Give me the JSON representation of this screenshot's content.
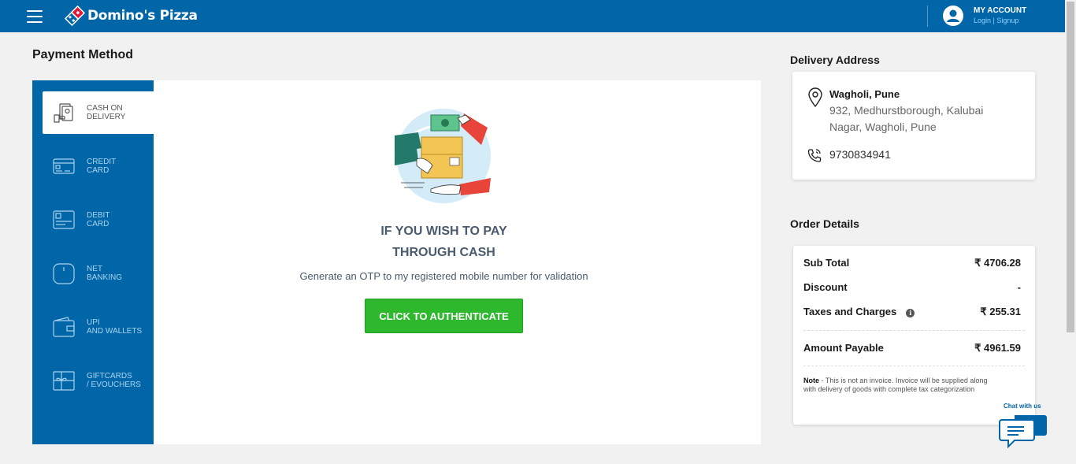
{
  "header": {
    "brand": "Domino's Pizza",
    "account_title": "MY ACCOUNT",
    "login": "Login",
    "separator": " | ",
    "signup": "Signup"
  },
  "payment": {
    "title": "Payment Method",
    "methods": [
      {
        "label": "CASH ON\nDELIVERY",
        "icon": "cash-icon",
        "active": true
      },
      {
        "label": "CREDIT\nCARD",
        "icon": "credit-card-icon",
        "active": false
      },
      {
        "label": "DEBIT\nCARD",
        "icon": "debit-card-icon",
        "active": false
      },
      {
        "label": "NET\nBANKING",
        "icon": "mouse-icon",
        "active": false
      },
      {
        "label": "UPI\nAND WALLETS",
        "icon": "wallet-icon",
        "active": false
      },
      {
        "label": "GIFTCARDS\n/ EVOUCHERS",
        "icon": "giftcard-icon",
        "active": false
      }
    ],
    "heading": "IF YOU WISH TO PAY\nTHROUGH CASH",
    "otp_text": "Generate an OTP to my registered mobile number for validation",
    "button": "CLICK TO AUTHENTICATE"
  },
  "delivery": {
    "title": "Delivery Address",
    "name": "Wagholi, Pune",
    "address": "932, Medhurstborough, Kalubai Nagar, Wagholi, Pune",
    "phone": "9730834941"
  },
  "order": {
    "title": "Order Details",
    "sub_total_label": "Sub Total",
    "sub_total": "₹ 4706.28",
    "discount_label": "Discount",
    "discount": "-",
    "taxes_label": "Taxes and Charges",
    "taxes": "₹ 255.31",
    "payable_label": "Amount Payable",
    "payable": "₹ 4961.59",
    "note_label": "Note",
    "note_text": " - This is not an invoice. Invoice will be supplied along with delivery of goods with complete tax categorization"
  },
  "chat": {
    "label": "Chat with us"
  },
  "colors": {
    "brand_blue": "#0066a8",
    "button_green": "#2eb82e",
    "brand_red": "#e31837"
  }
}
